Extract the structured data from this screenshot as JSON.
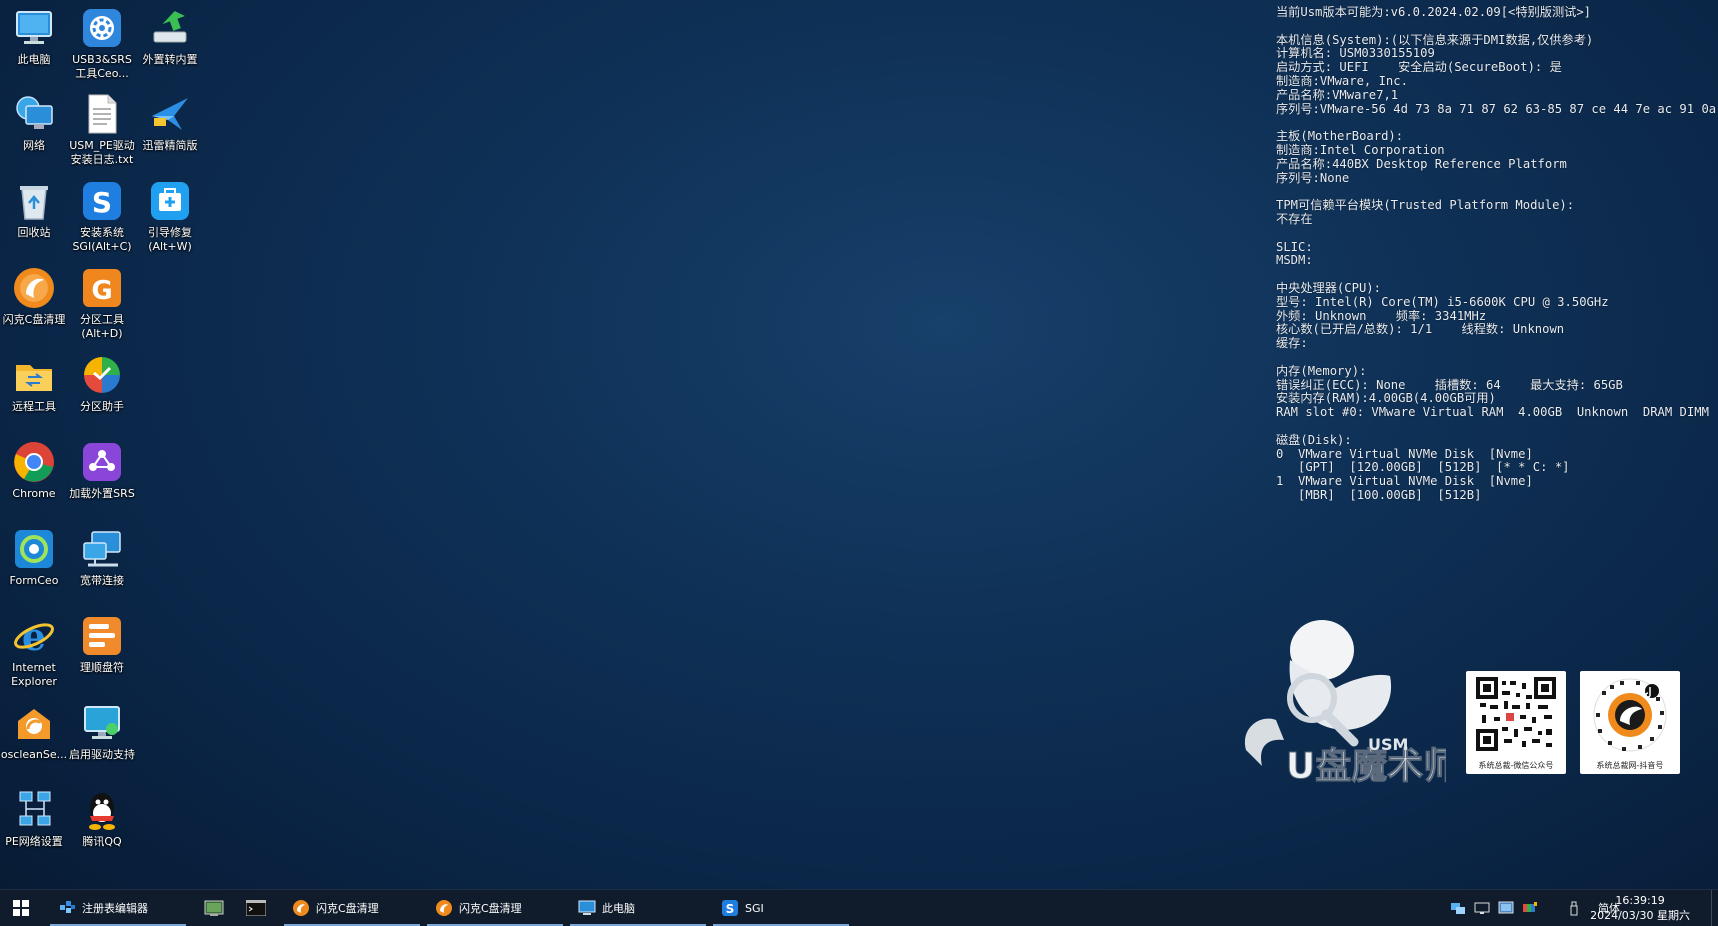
{
  "desktop": {
    "icons": [
      {
        "label": "此电脑",
        "icon": "computer-icon"
      },
      {
        "label": "USB3&SRS\n工具Ceo...",
        "icon": "usb-tools-icon"
      },
      {
        "label": "外置转内置",
        "icon": "convert-arrow-icon"
      },
      {
        "label": "网络",
        "icon": "network-icon"
      },
      {
        "label": "USM_PE驱动\n安装日志.txt",
        "icon": "text-file-icon"
      },
      {
        "label": "迅雷精简版",
        "icon": "thunder-icon"
      },
      {
        "label": "回收站",
        "icon": "recycle-bin-icon"
      },
      {
        "label": "安装系统\nSGI(Alt+C)",
        "icon": "sgi-icon"
      },
      {
        "label": "引导修复\n(Alt+W)",
        "icon": "boot-repair-icon"
      },
      {
        "label": "闪克C盘清理",
        "icon": "cleaner-icon"
      },
      {
        "label": "分区工具\n(Alt+D)",
        "icon": "partition-tool-icon"
      },
      {
        "label": "远程工具",
        "icon": "remote-folder-icon"
      },
      {
        "label": "分区助手",
        "icon": "partition-assistant-icon"
      },
      {
        "label": "Chrome",
        "icon": "chrome-icon"
      },
      {
        "label": "加载外置SRS",
        "icon": "srs-icon"
      },
      {
        "label": "FormCeo",
        "icon": "formceo-icon"
      },
      {
        "label": "宽带连接",
        "icon": "broadband-icon"
      },
      {
        "label": "Internet\nExplorer",
        "icon": "ie-icon"
      },
      {
        "label": "理顺盘符",
        "icon": "drive-letter-icon"
      },
      {
        "label": "oscleanSe...",
        "icon": "osclean-icon"
      },
      {
        "label": "启用驱动支持",
        "icon": "driver-support-icon"
      },
      {
        "label": "PE网络设置",
        "icon": "pe-network-icon"
      },
      {
        "label": "腾讯QQ",
        "icon": "qq-icon"
      }
    ]
  },
  "info_panel": {
    "lines": [
      "当前Usm版本可能为:v6.0.2024.02.09[<特别版测试>]",
      "",
      "本机信息(System):(以下信息来源于DMI数据,仅供参考)",
      "计算机名: USM0330155109",
      "启动方式: UEFI    安全启动(SecureBoot): 是",
      "制造商:VMware, Inc.",
      "产品名称:VMware7,1",
      "序列号:VMware-56 4d 73 8a 71 87 62 63-85 87 ce 44 7e ac 91 0a",
      "",
      "主板(MotherBoard):",
      "制造商:Intel Corporation",
      "产品名称:440BX Desktop Reference Platform",
      "序列号:None",
      "",
      "TPM可信赖平台模块(Trusted Platform Module):",
      "不存在",
      "",
      "SLIC:",
      "MSDM:",
      "",
      "中央处理器(CPU):",
      "型号: Intel(R) Core(TM) i5-6600K CPU @ 3.50GHz",
      "外频: Unknown    频率: 3341MHz",
      "核心数(已开启/总数): 1/1    线程数: Unknown",
      "缓存:",
      "",
      "内存(Memory):",
      "错误纠正(ECC): None    插槽数: 64    最大支持: 65GB",
      "安装内存(RAM):4.00GB(4.00GB可用)",
      "RAM slot #0: VMware Virtual RAM  4.00GB  Unknown  DRAM DIMM",
      "",
      "磁盘(Disk):",
      "0  VMware Virtual NVMe Disk  [Nvme]",
      "   [GPT]  [120.00GB]  [512B]  [* * C: *]",
      "1  VMware Virtual NVMe Disk  [Nvme]",
      "   [MBR]  [100.00GB]  [512B]"
    ]
  },
  "brand": {
    "logo_text": "U盘魔术师",
    "logo_badge": "USM",
    "qr_wechat_caption": "系统总裁-微信公众号",
    "qr_douyin_caption": "系统总裁网-抖音号"
  },
  "taskbar": {
    "items": [
      {
        "label": "注册表编辑器",
        "icon": "regedit-icon"
      },
      {
        "label": "",
        "icon": "explorer-window-icon"
      },
      {
        "label": "",
        "icon": "cmd-icon"
      },
      {
        "label": "闪克C盘清理",
        "icon": "cleaner-icon"
      },
      {
        "label": "闪克C盘清理",
        "icon": "cleaner-icon"
      },
      {
        "label": "此电脑",
        "icon": "computer-icon"
      },
      {
        "label": "SGI",
        "icon": "sgi-icon"
      }
    ],
    "ime": "简体",
    "time": "16:39:19",
    "date": "2024/03/30 星期六"
  }
}
